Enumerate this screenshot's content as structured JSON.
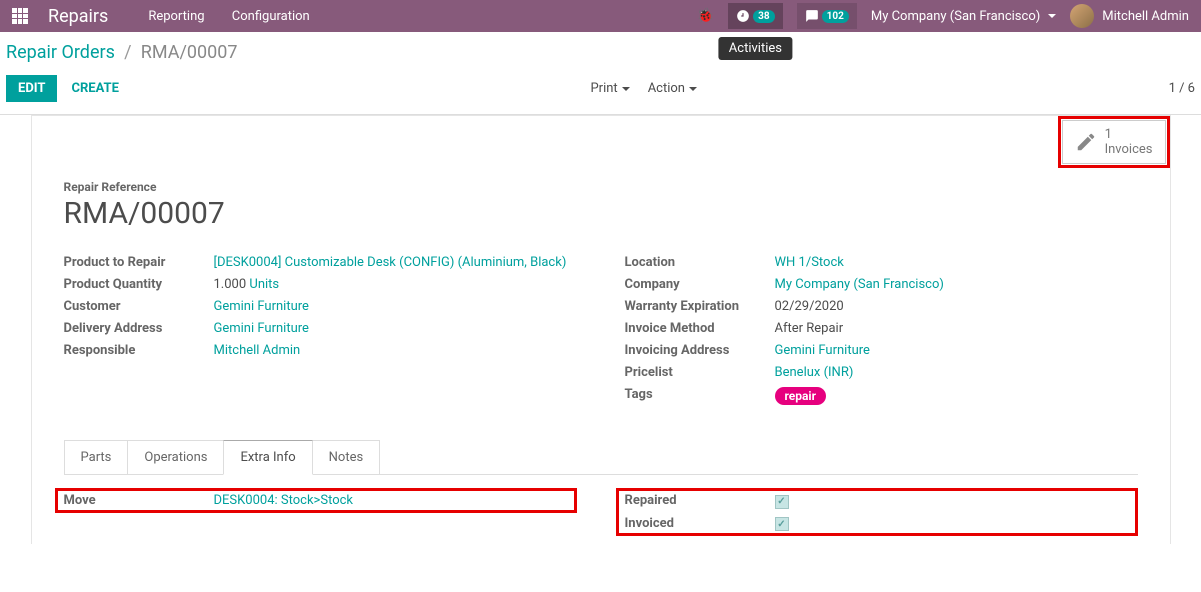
{
  "topbar": {
    "app_name": "Repairs",
    "nav": {
      "reporting": "Reporting",
      "configuration": "Configuration"
    },
    "activities_badge": "38",
    "messages_badge": "102",
    "activities_tooltip": "Activities",
    "company": "My Company (San Francisco)",
    "user": "Mitchell Admin"
  },
  "breadcrumb": {
    "parent": "Repair Orders",
    "current": "RMA/00007"
  },
  "actionbar": {
    "edit": "EDIT",
    "create": "CREATE",
    "print": "Print",
    "action": "Action",
    "pager": "1 / 6"
  },
  "statbtn": {
    "count": "1",
    "label": "Invoices"
  },
  "record": {
    "ref_label": "Repair Reference",
    "ref": "RMA/00007",
    "left": {
      "product_label": "Product to Repair",
      "product": "[DESK0004] Customizable Desk (CONFIG) (Aluminium, Black)",
      "qty_label": "Product Quantity",
      "qty_val": "1.000",
      "qty_uom": "Units",
      "customer_label": "Customer",
      "customer": "Gemini Furniture",
      "deliv_label": "Delivery Address",
      "deliv": "Gemini Furniture",
      "resp_label": "Responsible",
      "resp": "Mitchell Admin"
    },
    "right": {
      "location_label": "Location",
      "location": "WH 1/Stock",
      "company_label": "Company",
      "company": "My Company (San Francisco)",
      "warranty_label": "Warranty Expiration",
      "warranty": "02/29/2020",
      "invmethod_label": "Invoice Method",
      "invmethod": "After Repair",
      "invaddr_label": "Invoicing Address",
      "invaddr": "Gemini Furniture",
      "pricelist_label": "Pricelist",
      "pricelist": "Benelux (INR)",
      "tags_label": "Tags",
      "tag": "repair"
    }
  },
  "tabs": {
    "parts": "Parts",
    "operations": "Operations",
    "extra": "Extra Info",
    "notes": "Notes"
  },
  "extra": {
    "move_label": "Move",
    "move": "DESK0004: Stock>Stock",
    "repaired_label": "Repaired",
    "invoiced_label": "Invoiced"
  }
}
